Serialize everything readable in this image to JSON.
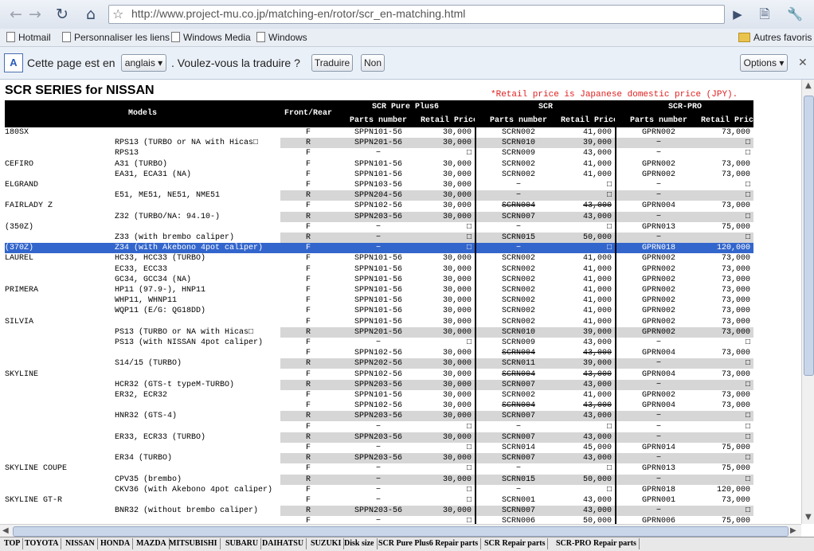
{
  "browser": {
    "url": "http://www.project-mu.co.jp/matching-en/rotor/scr_en-matching.html",
    "bookmarks": [
      "Hotmail",
      "Personnaliser les liens",
      "Windows Media",
      "Windows"
    ],
    "other_bookmarks": "Autres favoris",
    "translate": {
      "message": "Cette page est en",
      "language": "anglais",
      "question": ". Voulez-vous la traduire ?",
      "translate_button": "Traduire",
      "no_button": "Non",
      "options_button": "Options"
    }
  },
  "page": {
    "title": "SCR SERIES for NISSAN",
    "note": "*Retail price is Japanese domestic price (JPY).",
    "headers": {
      "models": "Models",
      "front_rear": "Front/Rear",
      "group1": "SCR Pure Plus6",
      "group2": "SCR",
      "group3": "SCR-PRO",
      "parts_number": "Parts number",
      "retail_price": "Retail Price"
    },
    "rows": [
      {
        "make": "180SX",
        "model": "",
        "fr": "F",
        "p1": "SPPN101-56",
        "r1": "30,000",
        "p2": "SCRN002",
        "r2": "41,000",
        "p3": "GPRN002",
        "r3": "73,000"
      },
      {
        "make": "",
        "model": "RPS13 (TURBO or NA with Hicas□",
        "fr": "R",
        "p1": "SPPN201-56",
        "r1": "30,000",
        "p2": "SCRN010",
        "r2": "39,000",
        "p3": "−",
        "r3": "□"
      },
      {
        "make": "",
        "model": "RPS13",
        "fr": "F",
        "p1": "−",
        "r1": "□",
        "p2": "SCRN009",
        "r2": "43,000",
        "p3": "−",
        "r3": "□"
      },
      {
        "make": "CEFIRO",
        "model": "A31 (TURBO)",
        "fr": "F",
        "p1": "SPPN101-56",
        "r1": "30,000",
        "p2": "SCRN002",
        "r2": "41,000",
        "p3": "GPRN002",
        "r3": "73,000"
      },
      {
        "make": "",
        "model": "EA31, ECA31 (NA)",
        "fr": "F",
        "p1": "SPPN101-56",
        "r1": "30,000",
        "p2": "SCRN002",
        "r2": "41,000",
        "p3": "GPRN002",
        "r3": "73,000"
      },
      {
        "make": "ELGRAND",
        "model": "",
        "fr": "F",
        "p1": "SPPN103-56",
        "r1": "30,000",
        "p2": "−",
        "r2": "□",
        "p3": "−",
        "r3": "□"
      },
      {
        "make": "",
        "model": "E51, ME51, NE51, NME51",
        "fr": "R",
        "p1": "SPPN204-56",
        "r1": "30,000",
        "p2": "−",
        "r2": "□",
        "p3": "−",
        "r3": "□"
      },
      {
        "make": "FAIRLADY Z",
        "model": "",
        "fr": "F",
        "p1": "SPPN102-56",
        "r1": "30,000",
        "p2": "SCRN004",
        "r2": "43,000",
        "p3": "GPRN004",
        "r3": "73,000",
        "strike2": true
      },
      {
        "make": "",
        "model": "Z32 (TURBO/NA: 94.10-)",
        "fr": "R",
        "p1": "SPPN203-56",
        "r1": "30,000",
        "p2": "SCRN007",
        "r2": "43,000",
        "p3": "−",
        "r3": "□"
      },
      {
        "make": "(350Z)",
        "model": "",
        "fr": "F",
        "p1": "−",
        "r1": "□",
        "p2": "−",
        "r2": "□",
        "p3": "GPRN013",
        "r3": "75,000"
      },
      {
        "make": "",
        "model": "Z33 (with brembo caliper)",
        "fr": "R",
        "p1": "−",
        "r1": "□",
        "p2": "SCRN015",
        "r2": "50,000",
        "p3": "−",
        "r3": "□"
      },
      {
        "make": "(370Z)",
        "model": "Z34 (with Akebono 4pot caliper)",
        "fr": "F",
        "p1": "−",
        "r1": "□",
        "p2": "−",
        "r2": "□",
        "p3": "GPRN018",
        "r3": "120,000",
        "selected": true
      },
      {
        "make": "LAUREL",
        "model": "HC33, HCC33 (TURBO)",
        "fr": "F",
        "p1": "SPPN101-56",
        "r1": "30,000",
        "p2": "SCRN002",
        "r2": "41,000",
        "p3": "GPRN002",
        "r3": "73,000"
      },
      {
        "make": "",
        "model": "EC33, ECC33",
        "fr": "F",
        "p1": "SPPN101-56",
        "r1": "30,000",
        "p2": "SCRN002",
        "r2": "41,000",
        "p3": "GPRN002",
        "r3": "73,000"
      },
      {
        "make": "",
        "model": "GC34, GCC34 (NA)",
        "fr": "F",
        "p1": "SPPN101-56",
        "r1": "30,000",
        "p2": "SCRN002",
        "r2": "41,000",
        "p3": "GPRN002",
        "r3": "73,000"
      },
      {
        "make": "PRIMERA",
        "model": "HP11 (97.9-), HNP11",
        "fr": "F",
        "p1": "SPPN101-56",
        "r1": "30,000",
        "p2": "SCRN002",
        "r2": "41,000",
        "p3": "GPRN002",
        "r3": "73,000"
      },
      {
        "make": "",
        "model": "WHP11, WHNP11",
        "fr": "F",
        "p1": "SPPN101-56",
        "r1": "30,000",
        "p2": "SCRN002",
        "r2": "41,000",
        "p3": "GPRN002",
        "r3": "73,000"
      },
      {
        "make": "",
        "model": "WQP11 (E/G: QG18DD)",
        "fr": "F",
        "p1": "SPPN101-56",
        "r1": "30,000",
        "p2": "SCRN002",
        "r2": "41,000",
        "p3": "GPRN002",
        "r3": "73,000"
      },
      {
        "make": "SILVIA",
        "model": "",
        "fr": "F",
        "p1": "SPPN101-56",
        "r1": "30,000",
        "p2": "SCRN002",
        "r2": "41,000",
        "p3": "GPRN002",
        "r3": "73,000"
      },
      {
        "make": "",
        "model": "PS13 (TURBO or NA with Hicas□",
        "fr": "R",
        "p1": "SPPN201-56",
        "r1": "30,000",
        "p2": "SCRN010",
        "r2": "39,000",
        "p3": "GPRN002",
        "r3": "73,000"
      },
      {
        "make": "",
        "model": "PS13 (with NISSAN 4pot caliper)",
        "fr": "F",
        "p1": "−",
        "r1": "□",
        "p2": "SCRN009",
        "r2": "43,000",
        "p3": "−",
        "r3": "□"
      },
      {
        "make": "",
        "model": "",
        "fr": "F",
        "p1": "SPPN102-56",
        "r1": "30,000",
        "p2": "SCRN004",
        "r2": "43,000",
        "p3": "GPRN004",
        "r3": "73,000",
        "strike2": true
      },
      {
        "make": "",
        "model": "S14/15 (TURBO)",
        "fr": "R",
        "p1": "SPPN202-56",
        "r1": "30,000",
        "p2": "SCRN011",
        "r2": "39,000",
        "p3": "−",
        "r3": "□"
      },
      {
        "make": "SKYLINE",
        "model": "",
        "fr": "F",
        "p1": "SPPN102-56",
        "r1": "30,000",
        "p2": "SCRN004",
        "r2": "43,000",
        "p3": "GPRN004",
        "r3": "73,000",
        "strike2": true
      },
      {
        "make": "",
        "model": "HCR32 (GTS-t typeM-TURBO)",
        "fr": "R",
        "p1": "SPPN203-56",
        "r1": "30,000",
        "p2": "SCRN007",
        "r2": "43,000",
        "p3": "−",
        "r3": "□"
      },
      {
        "make": "",
        "model": "ER32, ECR32",
        "fr": "F",
        "p1": "SPPN101-56",
        "r1": "30,000",
        "p2": "SCRN002",
        "r2": "41,000",
        "p3": "GPRN002",
        "r3": "73,000"
      },
      {
        "make": "",
        "model": "",
        "fr": "F",
        "p1": "SPPN102-56",
        "r1": "30,000",
        "p2": "SCRN004",
        "r2": "43,000",
        "p3": "GPRN004",
        "r3": "73,000",
        "strike2": true
      },
      {
        "make": "",
        "model": "HNR32 (GTS-4)",
        "fr": "R",
        "p1": "SPPN203-56",
        "r1": "30,000",
        "p2": "SCRN007",
        "r2": "43,000",
        "p3": "−",
        "r3": "□"
      },
      {
        "make": "",
        "model": "",
        "fr": "F",
        "p1": "−",
        "r1": "□",
        "p2": "−",
        "r2": "□",
        "p3": "−",
        "r3": "□"
      },
      {
        "make": "",
        "model": "ER33, ECR33 (TURBO)",
        "fr": "R",
        "p1": "SPPN203-56",
        "r1": "30,000",
        "p2": "SCRN007",
        "r2": "43,000",
        "p3": "−",
        "r3": "□"
      },
      {
        "make": "",
        "model": "",
        "fr": "F",
        "p1": "−",
        "r1": "□",
        "p2": "SCRN014",
        "r2": "45,000",
        "p3": "GPRN014",
        "r3": "75,000"
      },
      {
        "make": "",
        "model": "ER34 (TURBO)",
        "fr": "R",
        "p1": "SPPN203-56",
        "r1": "30,000",
        "p2": "SCRN007",
        "r2": "43,000",
        "p3": "−",
        "r3": "□"
      },
      {
        "make": "SKYLINE COUPE",
        "model": "",
        "fr": "F",
        "p1": "−",
        "r1": "□",
        "p2": "−",
        "r2": "□",
        "p3": "GPRN013",
        "r3": "75,000"
      },
      {
        "make": "",
        "model": "CPV35 (brembo)",
        "fr": "R",
        "p1": "−",
        "r1": "30,000",
        "p2": "SCRN015",
        "r2": "50,000",
        "p3": "−",
        "r3": "□"
      },
      {
        "make": "",
        "model": "CKV36 (with Akebono 4pot caliper)",
        "fr": "F",
        "p1": "−",
        "r1": "□",
        "p2": "−",
        "r2": "□",
        "p3": "GPRN018",
        "r3": "120,000"
      },
      {
        "make": "SKYLINE GT-R",
        "model": "",
        "fr": "F",
        "p1": "−",
        "r1": "□",
        "p2": "SCRN001",
        "r2": "43,000",
        "p3": "GPRN001",
        "r3": "73,000"
      },
      {
        "make": "",
        "model": "BNR32 (without brembo caliper)",
        "fr": "R",
        "p1": "SPPN203-56",
        "r1": "30,000",
        "p2": "SCRN007",
        "r2": "43,000",
        "p3": "−",
        "r3": "□"
      },
      {
        "make": "",
        "model": "",
        "fr": "F",
        "p1": "−",
        "r1": "□",
        "p2": "SCRN006",
        "r2": "50,000",
        "p3": "GPRN006",
        "r3": "75,000"
      }
    ]
  },
  "bottom_nav": [
    "TOP",
    "TOYOTA",
    "NISSAN",
    "HONDA",
    "MAZDA",
    "MITSUBISHI",
    "SUBARU",
    "DAIHATSU",
    "SUZUKI",
    "Disk size",
    "SCR Pure Plus6 Repair parts",
    "SCR Repair parts",
    "SCR-PRO Repair parts"
  ]
}
